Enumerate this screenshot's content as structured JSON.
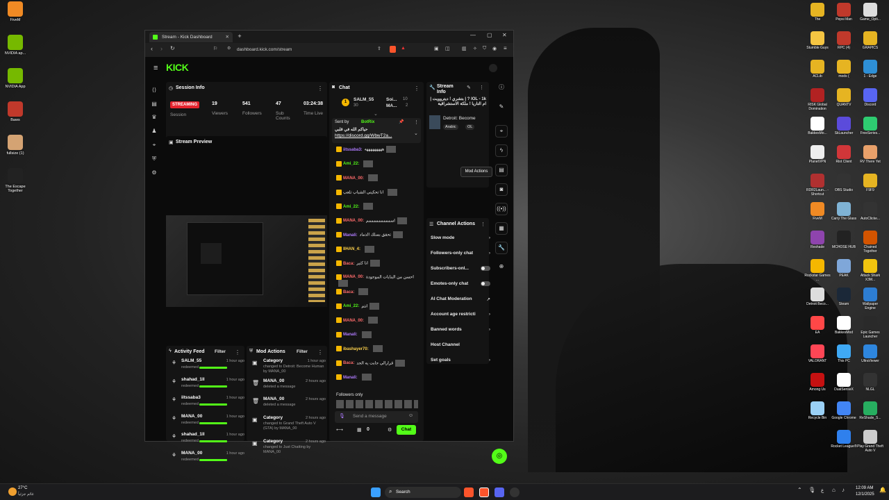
{
  "desktop_left": [
    {
      "label": "FiveM",
      "color": "#f08a24"
    },
    {
      "label": "NVIDIA ap...",
      "color": "#76b900"
    },
    {
      "label": "NVIDIA App",
      "color": "#76b900"
    },
    {
      "label": "Baws",
      "color": "#c0392b"
    },
    {
      "label": "fullsize (1)",
      "color": "#d4a373"
    },
    {
      "label": "The Escape Together",
      "color": "#222222"
    }
  ],
  "desktop_right": [
    {
      "label": "The",
      "color": "#e6b422"
    },
    {
      "label": "Pepsi Man",
      "color": "#c0392b"
    },
    {
      "label": "Game_Opti...",
      "color": "#dddddd"
    },
    {
      "label": "Stumble Guys",
      "color": "#f5c542"
    },
    {
      "label": "RPC (4)",
      "color": "#c0392b"
    },
    {
      "label": "GRAPICS",
      "color": "#e6b422"
    },
    {
      "label": "ACLib",
      "color": "#e6b422"
    },
    {
      "label": "mods (",
      "color": "#e6b422"
    },
    {
      "label": "1 - Edge",
      "color": "#2e8fd6"
    },
    {
      "label": "RISK Global Domination",
      "color": "#b22222"
    },
    {
      "label": "QUANTV",
      "color": "#e6b422"
    },
    {
      "label": "Discord",
      "color": "#5865f2"
    },
    {
      "label": "BakkesMo...",
      "color": "#ffffff"
    },
    {
      "label": "SkLauncher",
      "color": "#5b4bdb"
    },
    {
      "label": "FreeSeries...",
      "color": "#2ecc71"
    },
    {
      "label": "PlanetVPN",
      "color": "#eeeeee"
    },
    {
      "label": "Riot Client",
      "color": "#d13639"
    },
    {
      "label": "RV There Yet",
      "color": "#e8a06a"
    },
    {
      "label": "RDR2Laun... - Shortcut",
      "color": "#b03030"
    },
    {
      "label": "OBS Studio",
      "color": "#333333"
    },
    {
      "label": "F9F9",
      "color": "#e6b422"
    },
    {
      "label": "FiveM",
      "color": "#f08a24"
    },
    {
      "label": "Carry The Glass",
      "color": "#7fb3d5"
    },
    {
      "label": "AutoClicke...",
      "color": "#333333"
    },
    {
      "label": "Reshade",
      "color": "#8e44ad"
    },
    {
      "label": "MCHOSE HUB",
      "color": "#222222"
    },
    {
      "label": "Chained Together",
      "color": "#d35400"
    },
    {
      "label": "Rockstar Games ...",
      "color": "#f5b700"
    },
    {
      "label": "PEAK",
      "color": "#7fa7d9"
    },
    {
      "label": "Attack Shark X3M...",
      "color": "#f1c40f"
    },
    {
      "label": "Detroit Beco...",
      "color": "#dddddd"
    },
    {
      "label": "Steam",
      "color": "#1b2838"
    },
    {
      "label": "Wallpaper Engine",
      "color": "#2d7dd2"
    },
    {
      "label": "EA",
      "color": "#ff4747"
    },
    {
      "label": "BakkesMod",
      "color": "#ffffff"
    },
    {
      "label": "Epic Games Launcher",
      "color": "#2a2a2a"
    },
    {
      "label": "VALORANT",
      "color": "#ff4655"
    },
    {
      "label": "This PC",
      "color": "#3fa9f5"
    },
    {
      "label": "UltraViewer",
      "color": "#2e86de"
    },
    {
      "label": "Among Us",
      "color": "#c51111"
    },
    {
      "label": "DualSenseX",
      "color": "#ffffff"
    },
    {
      "label": "NLGL",
      "color": "#333333"
    },
    {
      "label": "Recycle Bin",
      "color": "#9ad0f5"
    },
    {
      "label": "Google Chrome",
      "color": "#4285f4"
    },
    {
      "label": "ReShade_S...",
      "color": "#27ae60"
    },
    {
      "label": "",
      "color": "transparent"
    },
    {
      "label": "Rocket League®",
      "color": "#2f80ed"
    },
    {
      "label": "Play Grand Theft Auto V",
      "color": "#cccccc"
    }
  ],
  "browser": {
    "tab_title": "Stream - Kick Dashboard",
    "url": "dashboard.kick.com/stream",
    "new_tab": "+",
    "logo": "KICK",
    "brand_color": "#53fc18"
  },
  "session": {
    "title": "Session Info",
    "badge": "STREAMING",
    "badge_sub": "Session",
    "viewers": "19",
    "viewers_label": "Viewers",
    "followers": "541",
    "followers_label": "Followers",
    "subs": "47",
    "subs_label": "Sub Counts",
    "time": "03:24:38",
    "time_label": "Time Live"
  },
  "preview": {
    "title": "Stream Preview"
  },
  "activity": {
    "title": "Activity Feed",
    "filter": "Filter",
    "items": [
      {
        "name": "SALM_55",
        "time": "1 hour ago",
        "sub": "redeemed"
      },
      {
        "name": "shahad_1ll",
        "time": "1 hour ago",
        "sub": "redeemed"
      },
      {
        "name": "iitssaba3",
        "time": "1 hour ago",
        "sub": "redeemed"
      },
      {
        "name": "MANA_00",
        "time": "1 hour ago",
        "sub": "redeemed"
      },
      {
        "name": "shahad_1ll",
        "time": "1 hour ago",
        "sub": "redeemed"
      },
      {
        "name": "MANA_00",
        "time": "1 hour ago",
        "sub": "redeemed"
      }
    ]
  },
  "modactions": {
    "title": "Mod Actions",
    "filter": "Filter",
    "items": [
      {
        "name": "Category",
        "time": "1 hour ago",
        "sub": "changed to Detroit: Become Human by MANA_00"
      },
      {
        "name": "MANA_00",
        "time": "2 hours ago",
        "sub": "deleted a message"
      },
      {
        "name": "MANA_00",
        "time": "2 hours ago",
        "sub": "deleted a message"
      },
      {
        "name": "Category",
        "time": "2 hours ago",
        "sub": "changed to Grand Theft Auto V (GTA) by MANA_00"
      },
      {
        "name": "Category",
        "time": "2 hours ago",
        "sub": "changed to Just Chatting by MANA_00"
      }
    ]
  },
  "chat": {
    "title": "Chat",
    "top_user": "SALM_55",
    "top_user_count": "30",
    "top_user2": "Soi...",
    "top_user2_count": "10",
    "top_user3": "MA...",
    "top_user3_count": "2",
    "pinned_by": "Sent by",
    "pinned_bot": "BotRix",
    "pinned_text": "حياكم الله في قلبي",
    "pinned_link": "https://discord.gg/WbwT2a...",
    "messages": [
      {
        "user": "iitssaba3:",
        "color": "#b07cff",
        "text": "هههههههههه"
      },
      {
        "user": "Ami_22:",
        "color": "#53fc18",
        "text": ""
      },
      {
        "user": "MANA_00:",
        "color": "#ff6b6b",
        "text": ""
      },
      {
        "user": "",
        "color": "#ffffff",
        "text": "انا تحكيني الشباب تلعب"
      },
      {
        "user": "Ami_22:",
        "color": "#53fc18",
        "text": ""
      },
      {
        "user": "MANA_00:",
        "color": "#ff6b6b",
        "text": "اسمممممممممم"
      },
      {
        "user": "Manali:",
        "color": "#b07cff",
        "text": "تحقق بسلك الذماد"
      },
      {
        "user": "IIHAN_4:",
        "color": "#ffd34d",
        "text": ""
      },
      {
        "user": "Baca:",
        "color": "#ff6b6b",
        "text": "انا كثير"
      },
      {
        "user": "MANA_00:",
        "color": "#ff6b6b",
        "text": "احسن من البنايات الموجودة"
      },
      {
        "user": "Baca:",
        "color": "#ff6b6b",
        "text": ""
      },
      {
        "user": "Ami_22:",
        "color": "#53fc18",
        "text": "انتم"
      },
      {
        "user": "MANA_00:",
        "color": "#ff6b6b",
        "text": ""
      },
      {
        "user": "Manali:",
        "color": "#b07cff",
        "text": ""
      },
      {
        "user": "ibashayer70:",
        "color": "#ffd34d",
        "text": ""
      },
      {
        "user": "Baca:",
        "color": "#ff6b6b",
        "text": "قرارالي جابت يه الجد"
      },
      {
        "user": "Manali:",
        "color": "#b07cff",
        "text": ""
      }
    ],
    "followers_only": "Followers only",
    "placeholder": "Send a message",
    "count": "0",
    "send": "Chat"
  },
  "streaminfo": {
    "title": "Stream Info",
    "stream_title": "IOL - 1k ? | بتشري ! ديتروويت | ام التاريا ! ملكة الاستشراقية",
    "category": "Detroit: Become",
    "tag1": "Arabic",
    "tag2": "OL"
  },
  "channel_actions": {
    "title": "Channel Actions",
    "items": [
      {
        "label": "Slow mode",
        "type": "chevron"
      },
      {
        "label": "Followers-only chat",
        "type": "chevron"
      },
      {
        "label": "Subscribers-onl...",
        "type": "toggle"
      },
      {
        "label": "Emotes-only chat",
        "type": "toggle"
      },
      {
        "label": "AI Chat Moderation",
        "type": "link"
      },
      {
        "label": "Account age restricti",
        "type": "chevron"
      },
      {
        "label": "Banned words",
        "type": "chevron"
      },
      {
        "label": "Host Channel",
        "type": "none"
      },
      {
        "label": "Set goals",
        "type": "chevron"
      }
    ]
  },
  "tooltip": "Mod Actions",
  "taskbar": {
    "weather_temp": "27°C",
    "weather_desc": "غائم جزئياً",
    "search": "Search",
    "time": "12:09 AM",
    "date": "12/1/2025",
    "lang": "ع"
  }
}
